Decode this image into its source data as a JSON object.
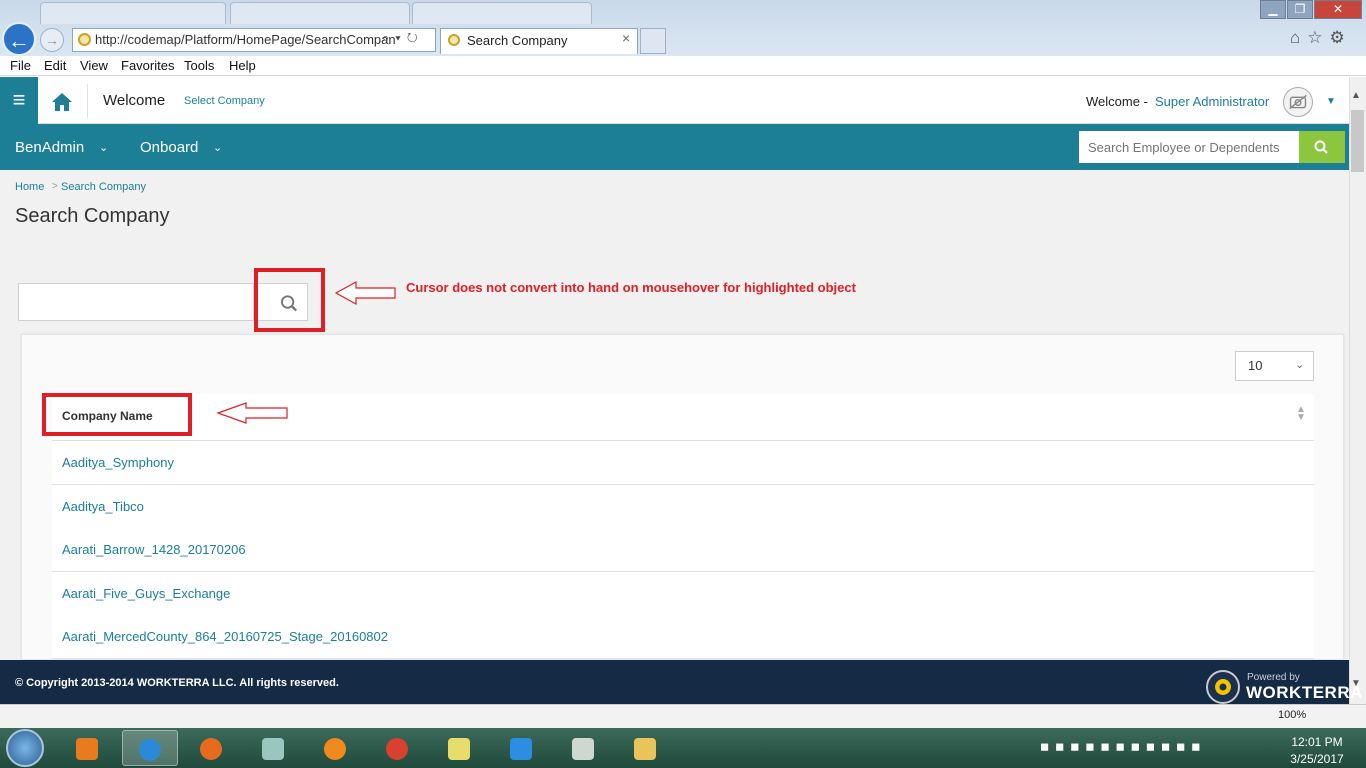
{
  "browser": {
    "address": "http://codemap/Platform/HomePage/SearchCompan",
    "address_tools": "⌕▾↻",
    "active_tab_title": "Search Company",
    "tab_close": "×",
    "menu": [
      "File",
      "Edit",
      "View",
      "Favorites",
      "Tools",
      "Help"
    ],
    "toolbar_icons": "⌂☆⚙",
    "zoom": "100%"
  },
  "header": {
    "welcome": "Welcome",
    "select_company": "Select Company",
    "welcome_user_prefix": "Welcome -",
    "user_name": "Super Administrator"
  },
  "nav": {
    "items": [
      "BenAdmin",
      "Onboard"
    ],
    "search_placeholder": "Search Employee or Dependents"
  },
  "breadcrumb": {
    "home": "Home",
    "separator": ">",
    "current": "Search Company"
  },
  "page": {
    "title": "Search Company",
    "annotation": "Cursor does not convert into hand on mousehover for highlighted object"
  },
  "table": {
    "page_size": "10",
    "column_header": "Company Name",
    "rows": [
      "Aaditya_Symphony",
      "Aaditya_Tibco",
      "Aarati_Barrow_1428_20170206",
      "Aarati_Five_Guys_Exchange",
      "Aarati_MercedCounty_864_20160725_Stage_20160802"
    ]
  },
  "footer": {
    "copyright": "© Copyright 2013-2014 WORKTERRA LLC. All rights reserved.",
    "powered_by": "Powered by",
    "brand": "WORKTERRA"
  },
  "taskbar": {
    "time": "12:01 PM",
    "date": "3/25/2017"
  },
  "colors": {
    "teal": "#1c7f96",
    "green": "#8cc63f",
    "footer": "#152a45",
    "annotation_red": "#e01e25"
  }
}
